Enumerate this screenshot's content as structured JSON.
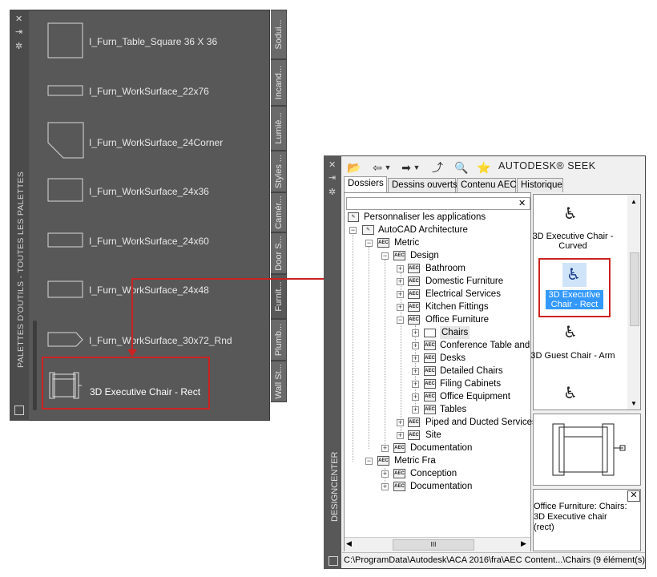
{
  "tool_palette": {
    "title": "PALETTES D'OUTILS - TOUTES LES PALETTES",
    "controls": {
      "close": "✕",
      "autohide": "⇥",
      "properties": "✲"
    },
    "tabs": [
      "Sodui...",
      "Incand...",
      "Lumiè...",
      "Styles ...",
      "Camér...",
      "Door S...",
      "Furnit...",
      "Plumb...",
      "Wall St..."
    ],
    "active_tab": "Furnit...",
    "tools": [
      "I_Furn_Table_Square 36 X 36",
      "I_Furn_WorkSurface_22x76",
      "I_Furn_WorkSurface_24Corner",
      "I_Furn_WorkSurface_24x36",
      "I_Furn_WorkSurface_24x60",
      "I_Furn_WorkSurface_24x48",
      "I_Furn_WorkSurface_30x72_Rnd"
    ],
    "dropped_tool": "3D Executive Chair - Rect"
  },
  "design_center": {
    "title": "DESIGNCENTER",
    "brand": "AUTODESK® SEEK",
    "tabs": [
      "Dossiers",
      "Dessins ouverts",
      "Contenu AEC",
      "Historique"
    ],
    "active_tab": "Dossiers",
    "tree_close": "✕",
    "tree": [
      "Personnaliser les applications",
      "AutoCAD Architecture",
      "Metric",
      "Design",
      "Bathroom",
      "Domestic Furniture",
      "Electrical Services",
      "Kitchen Fittings",
      "Office Furniture",
      "Chairs",
      "Conference Table and C",
      "Desks",
      "Detailed Chairs",
      "Filing Cabinets",
      "Office Equipment",
      "Tables",
      "Piped and Ducted Services",
      "Site",
      "Documentation",
      "Metric Fra",
      "Conception",
      "Documentation"
    ],
    "content_items": [
      "3D Executive Chair - Curved",
      "3D Executive Chair - Rect",
      "3D Guest Chair - Arm"
    ],
    "selected_item": "3D Executive Chair - Rect",
    "description": "Office Furniture: Chairs: 3D Executive chair (rect)",
    "status": "C:\\ProgramData\\Autodesk\\ACA 2016\\fra\\AEC Content...\\Chairs (9 élément(s))",
    "hscroll_grip": "III"
  }
}
